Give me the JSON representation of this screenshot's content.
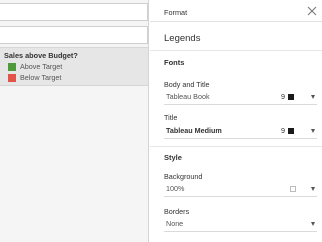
{
  "legend": {
    "title": "Sales above Budget?",
    "items": [
      {
        "label": "Above Target",
        "color": "#4f9a3c"
      },
      {
        "label": "Below Target",
        "color": "#e2534c"
      }
    ]
  },
  "format_pane": {
    "header_title": "Format",
    "title": "Legends",
    "fonts": {
      "heading": "Fonts",
      "body_title": {
        "label": "Body and Title",
        "value": "Tableau Book",
        "size": "9"
      },
      "title": {
        "label": "Title",
        "value": "Tableau Medium",
        "size": "9"
      }
    },
    "style": {
      "heading": "Style",
      "background": {
        "label": "Background",
        "value": "100%"
      },
      "borders": {
        "label": "Borders",
        "value": "None"
      }
    }
  }
}
